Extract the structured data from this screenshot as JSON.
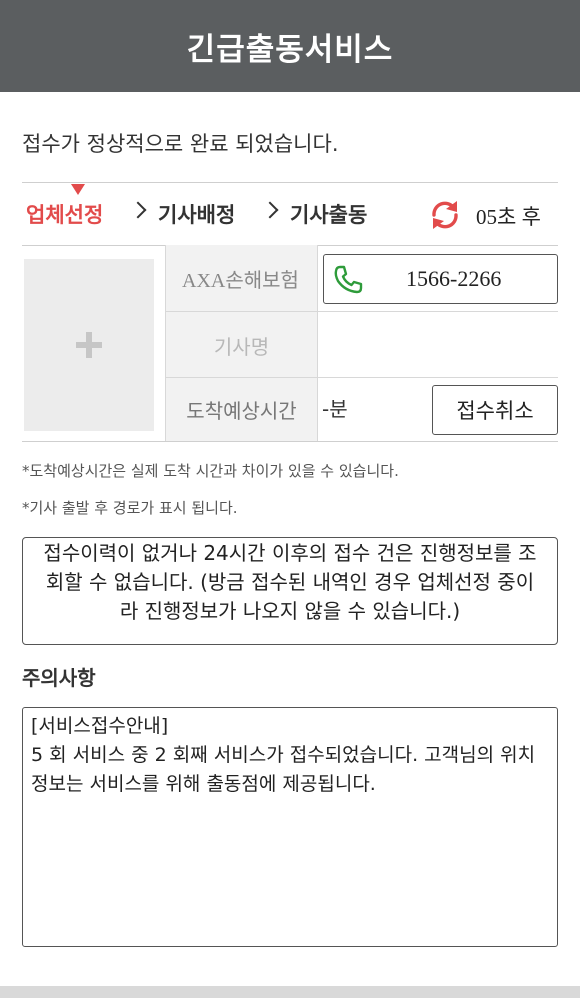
{
  "header": {
    "title": "긴급출동서비스"
  },
  "status_message": "접수가 정상적으로 완료 되었습니다.",
  "steps": {
    "items": [
      {
        "label": "업체선정",
        "active": true
      },
      {
        "label": "기사배정",
        "active": false
      },
      {
        "label": "기사출동",
        "active": false
      }
    ],
    "countdown": "05초 후",
    "refresh_icon": "refresh-icon"
  },
  "info": {
    "company": "AXA손해보험",
    "phone": "1566-2266",
    "driver_label": "기사명",
    "eta_label": "도착예상시간",
    "eta_value": "-분",
    "cancel_label": "접수취소"
  },
  "notes": [
    "*도착예상시간은 실제 도착 시간과 차이가 있을 수 있습니다.",
    "*기사 출발 후 경로가 표시 됩니다."
  ],
  "progress_message": "접수이력이 없거나 24시간 이후의 접수 건은 진행정보를 조회할 수 없습니다. (방금 접수된 내역인 경우 업체선정 중이라 진행정보가 나오지 않을 수 있습니다.)",
  "caution": {
    "title": "주의사항",
    "heading": "[서비스접수안내]",
    "body": "5 회 서비스 중 2 회째 서비스가 접수되었습니다. 고객님의 위치정보는 서비스를 위해 출동점에 제공됩니다."
  },
  "colors": {
    "accent": "#e24b4b",
    "header_bg": "#5b5e60",
    "phone_green": "#2e9b3a"
  }
}
